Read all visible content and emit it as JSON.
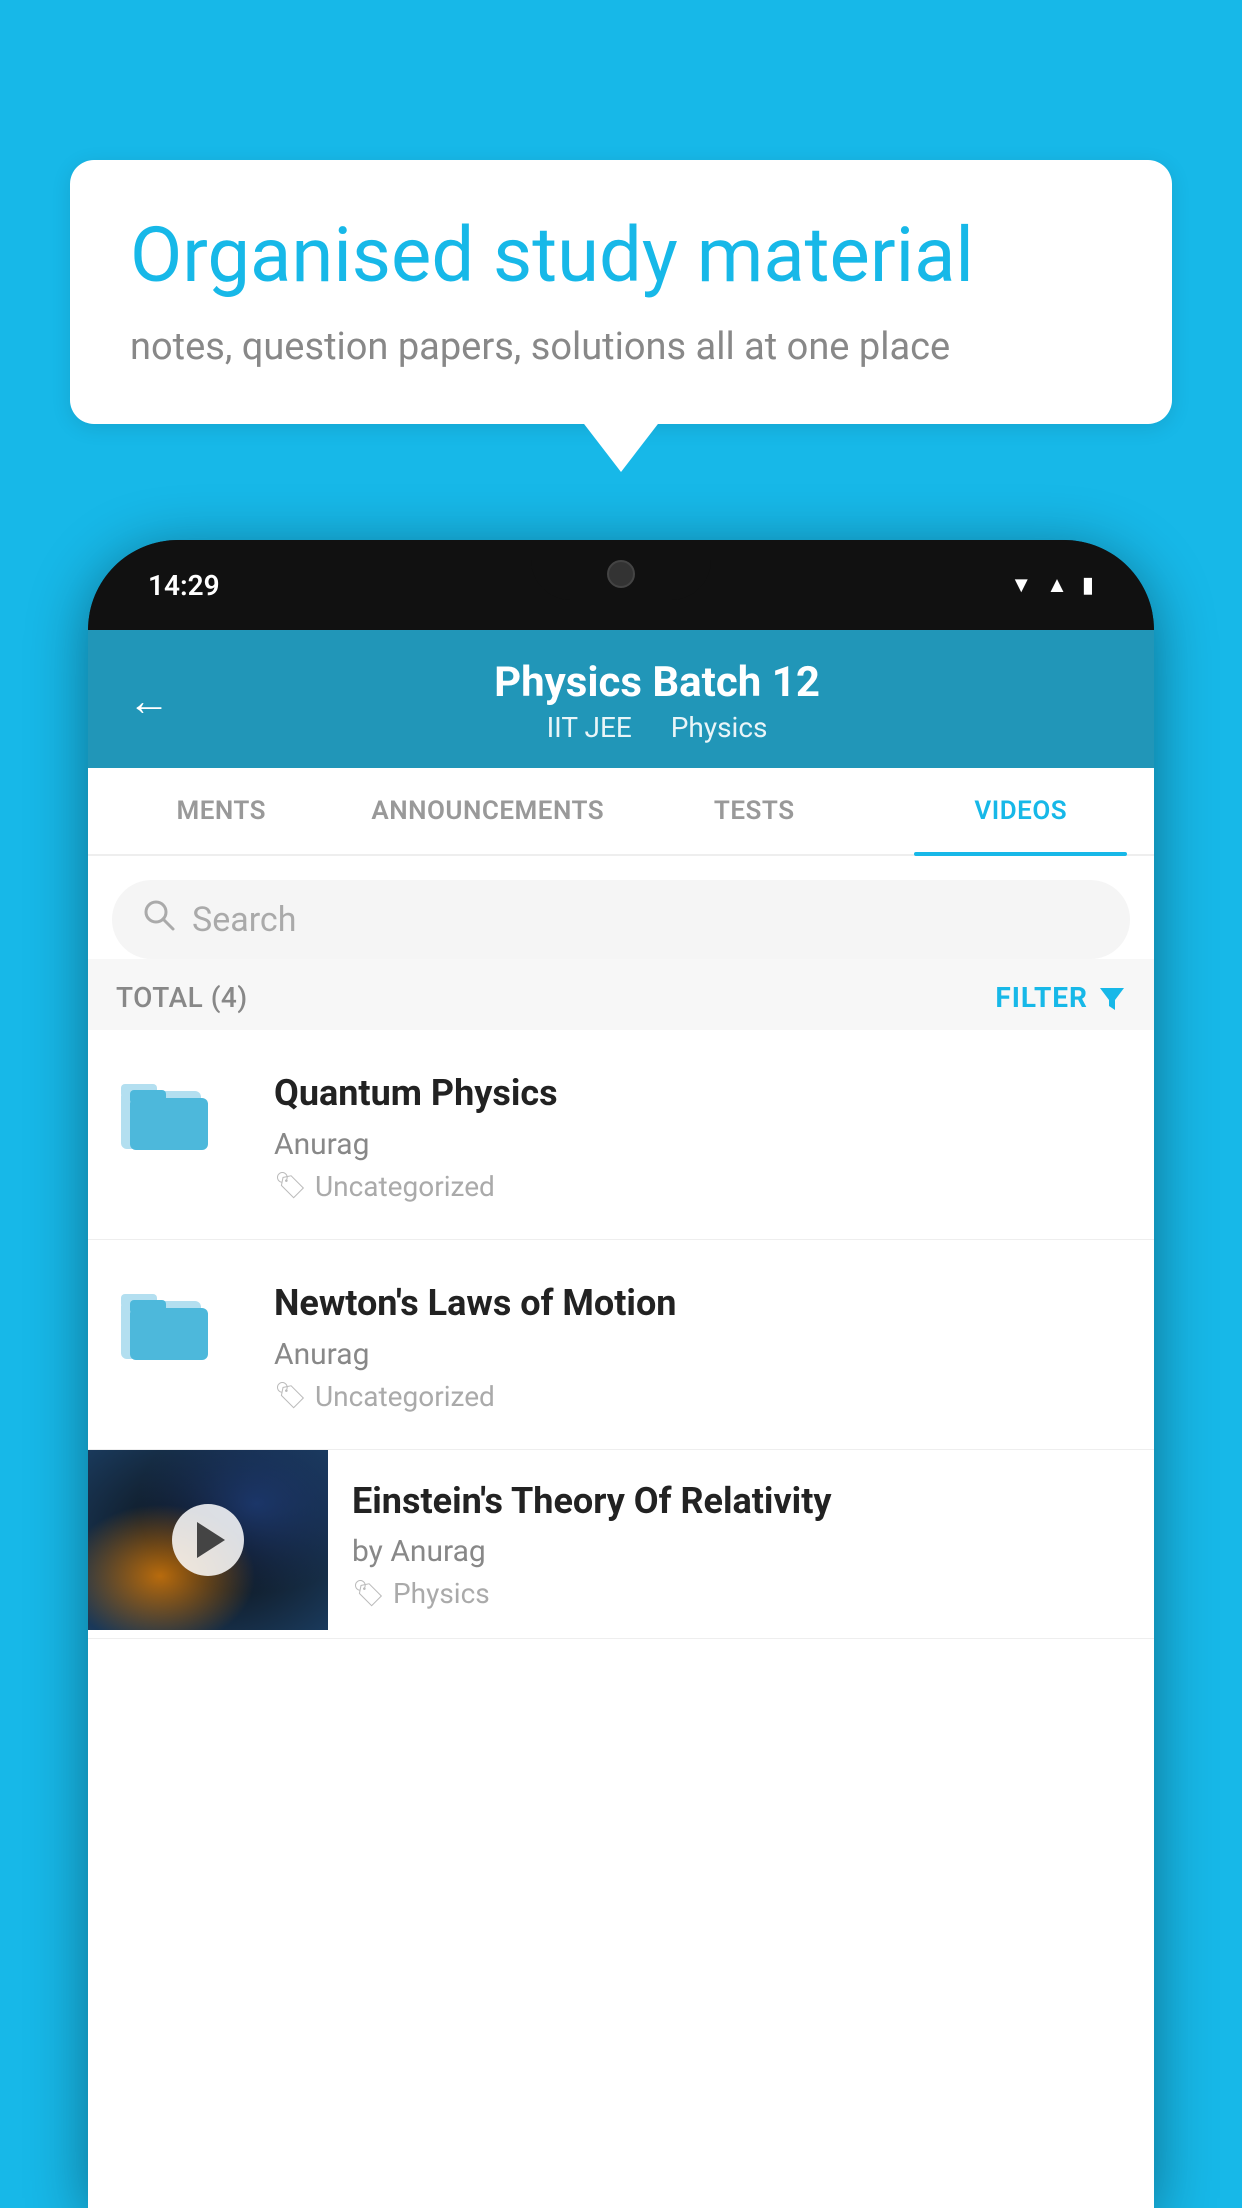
{
  "background_color": "#17b8e8",
  "speech_bubble": {
    "title": "Organised study material",
    "subtitle": "notes, question papers, solutions all at one place"
  },
  "phone": {
    "status_bar": {
      "time": "14:29"
    },
    "app_header": {
      "title": "Physics Batch 12",
      "subtitle1": "IIT JEE",
      "subtitle2": "Physics",
      "back_label": "←"
    },
    "tabs": [
      {
        "label": "MENTS",
        "active": false
      },
      {
        "label": "ANNOUNCEMENTS",
        "active": false
      },
      {
        "label": "TESTS",
        "active": false
      },
      {
        "label": "VIDEOS",
        "active": true
      }
    ],
    "search": {
      "placeholder": "Search"
    },
    "filter_row": {
      "total_label": "TOTAL (4)",
      "filter_label": "FILTER"
    },
    "videos": [
      {
        "title": "Quantum Physics",
        "author": "Anurag",
        "tag": "Uncategorized",
        "has_thumb": false
      },
      {
        "title": "Newton's Laws of Motion",
        "author": "Anurag",
        "tag": "Uncategorized",
        "has_thumb": false
      },
      {
        "title": "Einstein's Theory Of Relativity",
        "author": "by Anurag",
        "tag": "Physics",
        "has_thumb": true
      }
    ]
  }
}
